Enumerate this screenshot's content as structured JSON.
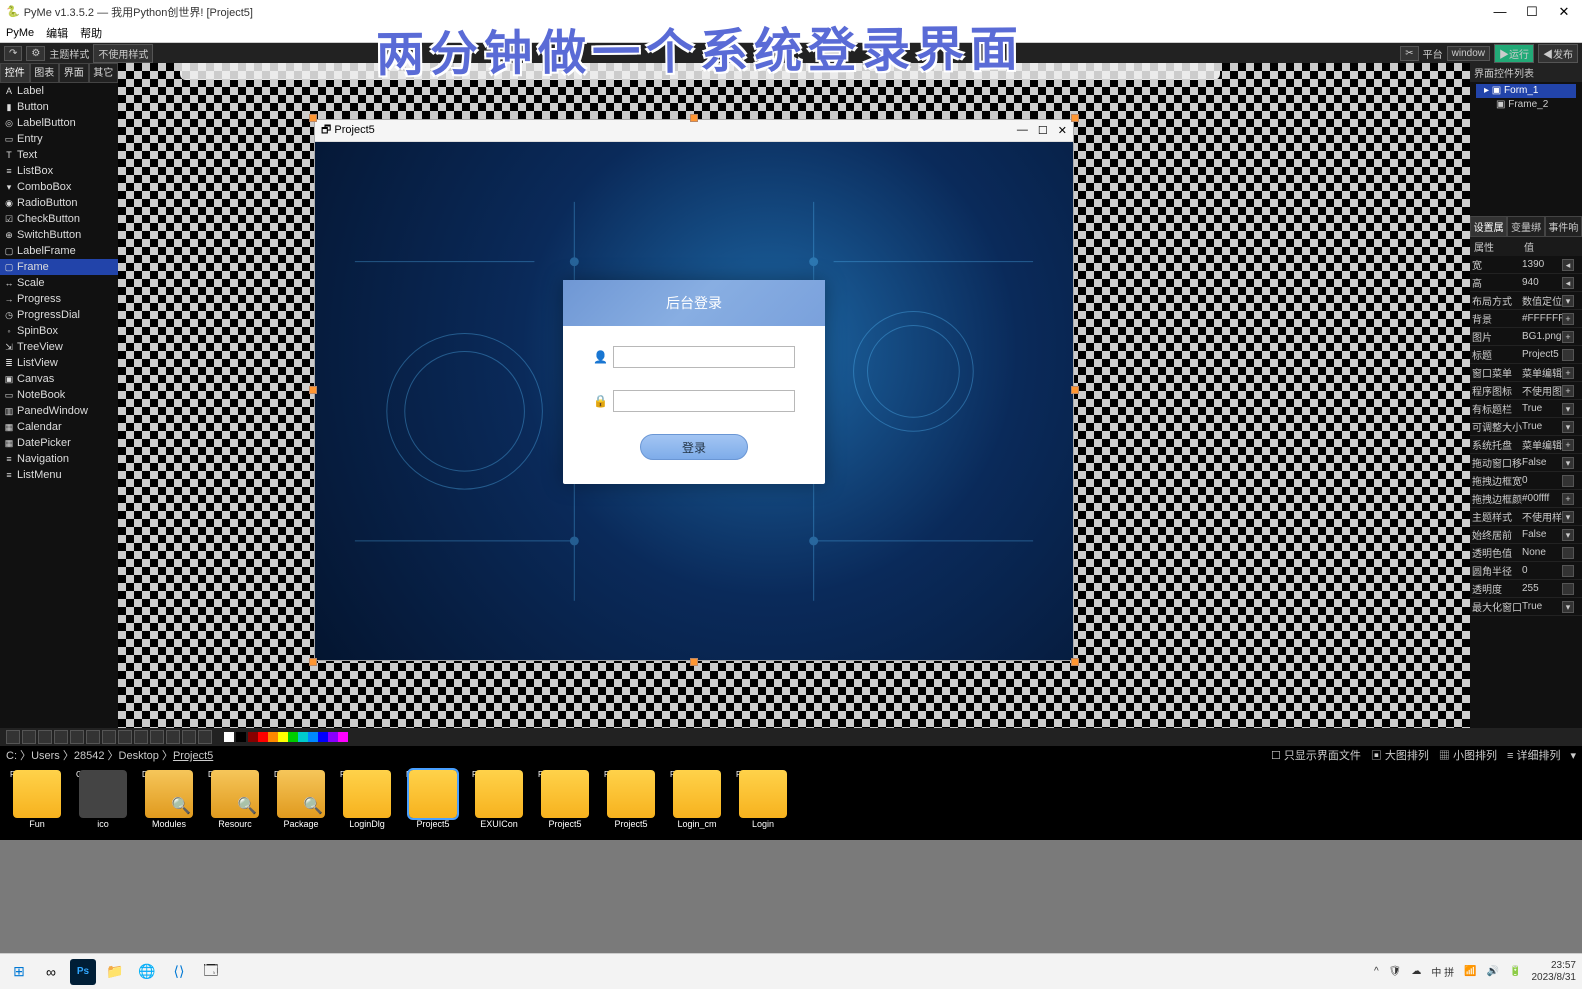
{
  "app": {
    "title": "PyMe v1.3.5.2 — 我用Python创世界!   [Project5]"
  },
  "menu": [
    "PyMe",
    "编辑",
    "帮助"
  ],
  "toolbar": {
    "theme_label": "主题样式",
    "theme_value": "不使用样式",
    "platform_label": "平台",
    "platform_value": "window",
    "run_label": "▶运行",
    "publish_label": "◀发布"
  },
  "left": {
    "tabs": [
      "控件",
      "图表",
      "界面",
      "其它"
    ],
    "widgets": [
      {
        "icon": "A",
        "name": "Label"
      },
      {
        "icon": "▮",
        "name": "Button"
      },
      {
        "icon": "◎",
        "name": "LabelButton"
      },
      {
        "icon": "▭",
        "name": "Entry"
      },
      {
        "icon": "T",
        "name": "Text"
      },
      {
        "icon": "≡",
        "name": "ListBox"
      },
      {
        "icon": "▾",
        "name": "ComboBox"
      },
      {
        "icon": "◉",
        "name": "RadioButton"
      },
      {
        "icon": "☑",
        "name": "CheckButton"
      },
      {
        "icon": "⊕",
        "name": "SwitchButton"
      },
      {
        "icon": "▢",
        "name": "LabelFrame"
      },
      {
        "icon": "▢",
        "name": "Frame",
        "sel": true
      },
      {
        "icon": "↔",
        "name": "Scale"
      },
      {
        "icon": "→",
        "name": "Progress"
      },
      {
        "icon": "◷",
        "name": "ProgressDial"
      },
      {
        "icon": "◦",
        "name": "SpinBox"
      },
      {
        "icon": "⇲",
        "name": "TreeView"
      },
      {
        "icon": "≣",
        "name": "ListView"
      },
      {
        "icon": "▣",
        "name": "Canvas"
      },
      {
        "icon": "▭",
        "name": "NoteBook"
      },
      {
        "icon": "▥",
        "name": "PanedWindow"
      },
      {
        "icon": "▦",
        "name": "Calendar"
      },
      {
        "icon": "▦",
        "name": "DatePicker"
      },
      {
        "icon": "≡",
        "name": "Navigation"
      },
      {
        "icon": "≡",
        "name": "ListMenu"
      }
    ]
  },
  "design": {
    "title": "Project5",
    "login_title": "后台登录",
    "login_btn": "登录"
  },
  "right": {
    "panel_title": "界面控件列表",
    "tree": [
      {
        "name": "Form_1",
        "sel": true,
        "children": [
          {
            "name": "Frame_2"
          }
        ]
      }
    ],
    "prop_tabs": [
      "设置属",
      "变量绑",
      "事件响"
    ],
    "prop_head": [
      "属性",
      "值"
    ],
    "props": [
      {
        "n": "宽",
        "v": "1390",
        "b": "◂"
      },
      {
        "n": "高",
        "v": "940",
        "b": "◂"
      },
      {
        "n": "布局方式",
        "v": "数值定位",
        "b": "▾"
      },
      {
        "n": "背景",
        "v": "#FFFFFF",
        "b": "+"
      },
      {
        "n": "图片",
        "v": "BG1.png",
        "b": "+"
      },
      {
        "n": "标题",
        "v": "Project5",
        "b": ""
      },
      {
        "n": "窗口菜单",
        "v": "菜单编辑",
        "b": "+"
      },
      {
        "n": "程序图标",
        "v": "不使用图",
        "b": "+"
      },
      {
        "n": "有标题栏",
        "v": "True",
        "b": "▾"
      },
      {
        "n": "可调整大小",
        "v": "True",
        "b": "▾"
      },
      {
        "n": "系统托盘",
        "v": "菜单编辑",
        "b": "+"
      },
      {
        "n": "拖动窗口移",
        "v": "False",
        "b": "▾"
      },
      {
        "n": "拖拽边框宽度",
        "v": "0",
        "b": ""
      },
      {
        "n": "拖拽边框颜色",
        "v": "#00ffff",
        "b": "+"
      },
      {
        "n": "主题样式",
        "v": "不使用样",
        "b": "▾"
      },
      {
        "n": "始终居前",
        "v": "False",
        "b": "▾"
      },
      {
        "n": "透明色值",
        "v": "None",
        "b": ""
      },
      {
        "n": "圆角半径",
        "v": "0",
        "b": ""
      },
      {
        "n": "透明度",
        "v": "255",
        "b": ""
      },
      {
        "n": "最大化窗口",
        "v": "True",
        "b": "▾"
      }
    ]
  },
  "path": {
    "segments": [
      "C:",
      "Users",
      "28542",
      "Desktop",
      "Project5"
    ],
    "right": [
      "只显示界面文件",
      "大图排列",
      "小图排列",
      "详细排列"
    ]
  },
  "files": [
    {
      "type": "FILE",
      "name": "Fun",
      "cls": "fi-py"
    },
    {
      "type": "CO",
      "name": "ico",
      "cls": ""
    },
    {
      "type": "DIR",
      "name": "Modules",
      "cls": "fi-dir"
    },
    {
      "type": "DIR",
      "name": "Resourc",
      "cls": "fi-dir"
    },
    {
      "type": "DIR",
      "name": "Package",
      "cls": "fi-dir"
    },
    {
      "type": "FILE",
      "name": "LoginDlg",
      "cls": "fi-py"
    },
    {
      "type": "PY-WI",
      "name": "Project5",
      "cls": "fi-py",
      "sel": true
    },
    {
      "type": "FILE",
      "name": "EXUICon",
      "cls": "fi-py"
    },
    {
      "type": "PY-CM",
      "name": "Project5",
      "cls": "fi-py"
    },
    {
      "type": "PY-ST",
      "name": "Project5",
      "cls": "fi-py"
    },
    {
      "type": "PY-CM",
      "name": "Login_cm",
      "cls": "fi-py"
    },
    {
      "type": "PY-WI",
      "name": "Login",
      "cls": "fi-py"
    }
  ],
  "banner": "两分钟做一个系统登录界面",
  "taskbar": {
    "ime": "中 拼",
    "time": "23:57",
    "date": "2023/8/31"
  }
}
